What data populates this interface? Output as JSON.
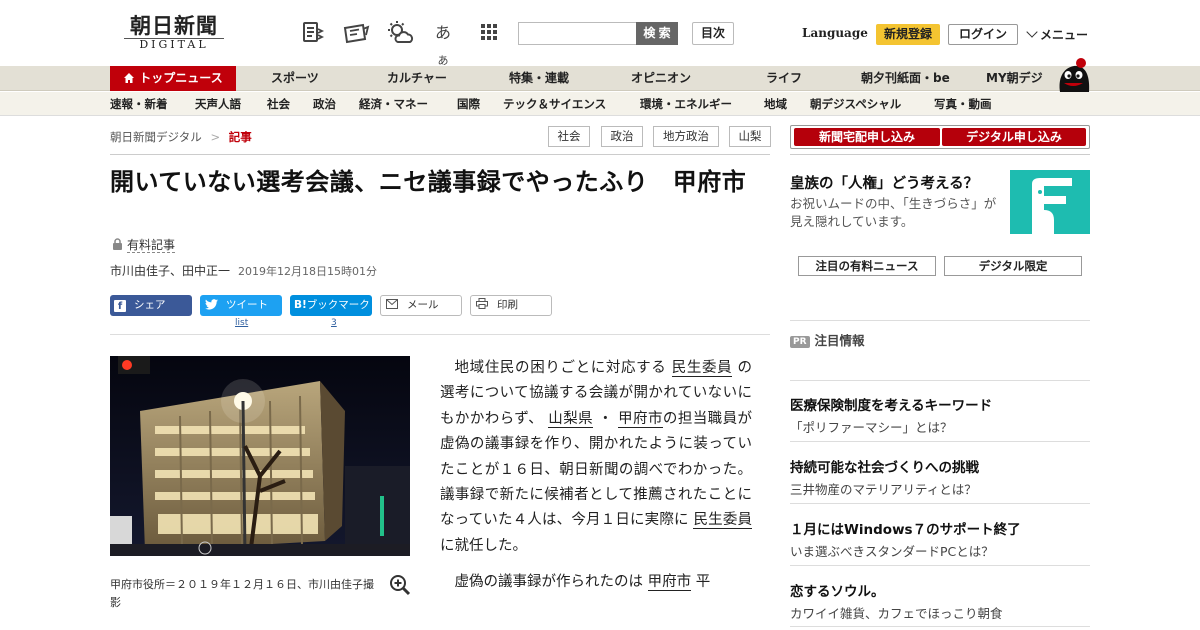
{
  "header": {
    "logo_main": "朝日新聞",
    "logo_sub": "DIGITAL",
    "icons": [
      "news-list-icon",
      "newspaper-icon",
      "weather-icon",
      "font-size-icon",
      "app-grid-icon"
    ],
    "font_size_glyph": "あ",
    "font_size_glyph_small": "あ",
    "search_placeholder": "",
    "search_button": "検 索",
    "toc_button": "目次",
    "language": "Language",
    "register": "新規登録",
    "login": "ログイン",
    "menu": "メニュー"
  },
  "global_nav": {
    "items": [
      "トップニュース",
      "スポーツ",
      "カルチャー",
      "特集・連載",
      "オピニオン",
      "ライフ",
      "朝夕刊紙面・be",
      "MY朝デジ"
    ]
  },
  "sub_nav": {
    "items": [
      "速報・新着",
      "天声人語",
      "社会",
      "政治",
      "経済・マネー",
      "国際",
      "テック＆サイエンス",
      "環境・エネルギー",
      "地域",
      "朝デジスペシャル",
      "写真・動画"
    ]
  },
  "breadcrumb": {
    "home": "朝日新聞デジタル",
    "separator": ">",
    "current": "記事"
  },
  "tags": [
    "社会",
    "政治",
    "地方政治",
    "山梨"
  ],
  "article": {
    "title": "開いていない選考会議、ニセ議事録でやったふり　甲府市",
    "paid_label": "有料記事",
    "authors": "市川由佳子、田中正一",
    "date": "2019年12月18日15時01分",
    "photo_caption": "甲府市役所＝２０１９年１２月１６日、市川由佳子撮影",
    "p1": {
      "t1": "地域住民の困りごとに対応する",
      "l1": "民生委員",
      "t2": "の選考について協議する会議が開かれていないにもかかわらず、",
      "l2": "山梨県",
      "t3": "・",
      "l3": "甲府市",
      "t4": "の担当職員が虚偽の議事録を作り、開かれたように装っていたことが１６日、朝日新聞の調べでわかった。議事録で新たに候補者として推薦されたことになっていた４人は、今月１日に実際に",
      "l4": "民生委員",
      "t5": "に就任した。"
    },
    "p2": {
      "t1": "虚偽の議事録が作られたのは",
      "l1": "甲府市",
      "t2": "平"
    }
  },
  "share": {
    "facebook": "シェア",
    "twitter": "ツイート",
    "twitter_count": "list",
    "hatena": "ブックマーク",
    "hatena_icon": "B!",
    "hatena_count": "3",
    "mail": "メール",
    "print": "印刷"
  },
  "sidebar": {
    "delivery_button": "新聞宅配申し込み",
    "digital_button": "デジタル申し込み",
    "promo_title": "皇族の「人権」どう考える？",
    "promo_text": "お祝いムードの中、「生きづらさ」が見え隠れしています。",
    "tab_paid": "注目の有料ニュース",
    "tab_digital": "デジタル限定",
    "pr_badge": "PR",
    "pr_heading": "注目情報",
    "pr_items": [
      {
        "title": "医療保険制度を考えるキーワード",
        "sub": "「ポリファーマシー」とは？"
      },
      {
        "title": "持続可能な社会づくりへの挑戦",
        "sub": "三井物産のマテリアリティとは？"
      },
      {
        "title": "１月にはWindows７のサポート終了",
        "sub": "いま選ぶべきスタンダードPCとは？"
      },
      {
        "title": "恋するソウル。",
        "sub": "カワイイ雑貨、カフェでほっこり朝食"
      }
    ]
  },
  "colors": {
    "accent_red": "#c0000a",
    "register_yellow": "#f4c431",
    "nav_beige": "#e3e0d5",
    "facebook": "#3b5998",
    "twitter": "#1da1f2",
    "hatena": "#008fde",
    "teal": "#1ebcb0"
  }
}
